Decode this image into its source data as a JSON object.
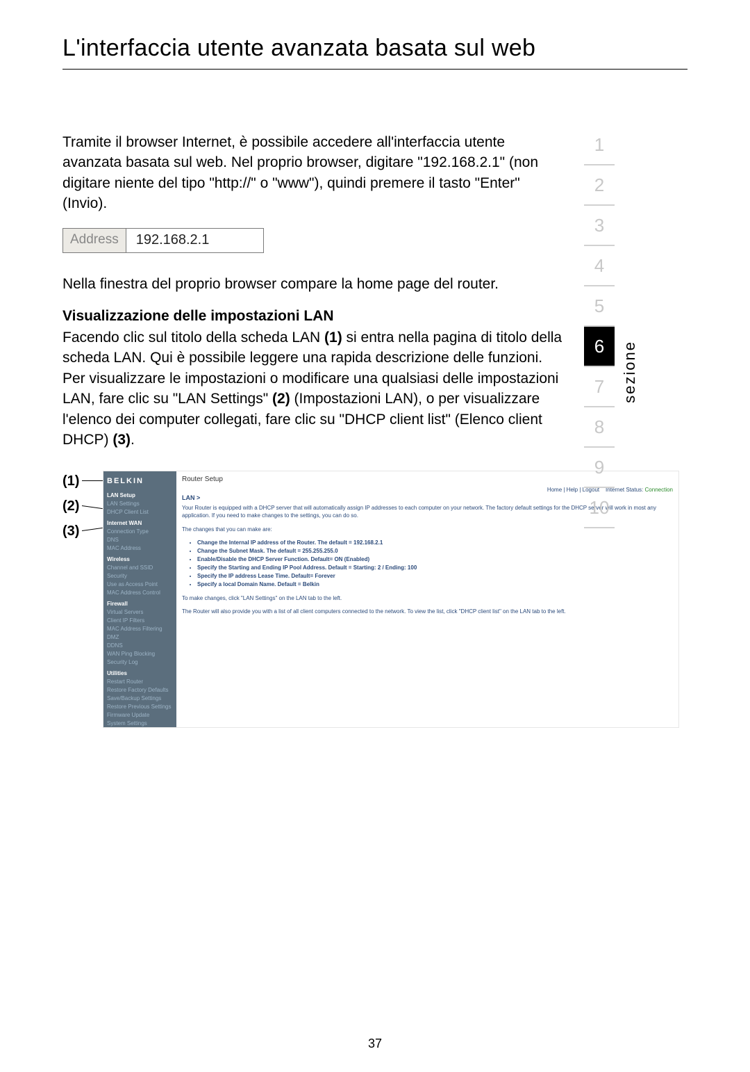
{
  "page": {
    "title": "L'interfaccia utente avanzata basata sul web",
    "intro": "Tramite il browser Internet, è possibile accedere all'interfaccia utente avanzata basata sul web. Nel proprio browser, digitare \"192.168.2.1\" (non digitare niente del tipo \"http://\" o \"www\"), quindi premere il tasto \"Enter\" (Invio).",
    "address_label": "Address",
    "address_value": "192.168.2.1",
    "after_address": "Nella finestra del proprio browser compare la home page del router.",
    "subhead": "Visualizzazione delle impostazioni LAN",
    "para2_a": "Facendo clic sul titolo della scheda LAN ",
    "b1": "(1)",
    "para2_b": " si entra nella pagina di titolo della scheda LAN. Qui è possibile leggere una rapida descrizione delle funzioni. Per visualizzare le impostazioni o modificare una qualsiasi delle impostazioni LAN, fare clic su \"LAN Settings\" ",
    "b2": "(2)",
    "para2_c": " (Impostazioni LAN), o per visualizzare l'elenco dei computer collegati, fare clic su \"DHCP client list\" (Elenco client DHCP) ",
    "b3": "(3)",
    "para2_d": ".",
    "page_number": "37"
  },
  "tabs": {
    "items": [
      "1",
      "2",
      "3",
      "4",
      "5",
      "6",
      "7",
      "8",
      "9",
      "10"
    ],
    "active_index": 5,
    "label": "sezione"
  },
  "callouts": {
    "c1": "(1)",
    "c2": "(2)",
    "c3": "(3)"
  },
  "router": {
    "brand": "BELKIN",
    "setup_title": "Router Setup",
    "topbar_links": "Home | Help | Logout",
    "topbar_status_label": "Internet Status:",
    "topbar_status_value": "Connection",
    "sidebar": {
      "lan_setup": "LAN Setup",
      "lan_settings": "LAN Settings",
      "dhcp_client": "DHCP Client List",
      "internet_wan": "Internet WAN",
      "conn_type": "Connection Type",
      "dns": "DNS",
      "mac": "MAC Address",
      "wireless": "Wireless",
      "channel": "Channel and SSID",
      "security": "Security",
      "use_ap": "Use as Access Point",
      "mac_ctrl": "MAC Address Control",
      "firewall": "Firewall",
      "vservers": "Virtual Servers",
      "cfilters": "Client IP Filters",
      "mac_filter": "MAC Address Filtering",
      "dmz": "DMZ",
      "ddns": "DDNS",
      "ping_block": "WAN Ping Blocking",
      "seclog": "Security Log",
      "utilities": "Utilities",
      "restart": "Restart Router",
      "restore_defaults": "Restore Factory Defaults",
      "save_backup": "Save/Backup Settings",
      "restore_prev": "Restore Previous Settings",
      "fw_update": "Firmware Update",
      "sys_settings": "System Settings"
    },
    "content": {
      "breadcrumb": "LAN >",
      "p1": "Your Router is equipped with a DHCP server that will automatically assign IP addresses to each computer on your network. The factory default settings for the DHCP server will work in most any application. If you need to make changes to the settings, you can do so.",
      "p2": "The changes that you can make are:",
      "bullets": [
        "Change the Internal IP address of the Router. The default = 192.168.2.1",
        "Change the Subnet Mask. The default = 255.255.255.0",
        "Enable/Disable the DHCP Server Function. Default= ON (Enabled)",
        "Specify the Starting and Ending IP Pool Address. Default = Starting: 2 / Ending: 100",
        "Specify the IP address Lease Time. Default= Forever",
        "Specify a local Domain Name. Default = Belkin"
      ],
      "p3": "To make changes, click \"LAN Settings\" on the LAN tab to the left.",
      "p4": "The Router will also provide you with a list of all client computers connected to the network. To view the list, click \"DHCP client list\" on the LAN tab to the left."
    }
  }
}
